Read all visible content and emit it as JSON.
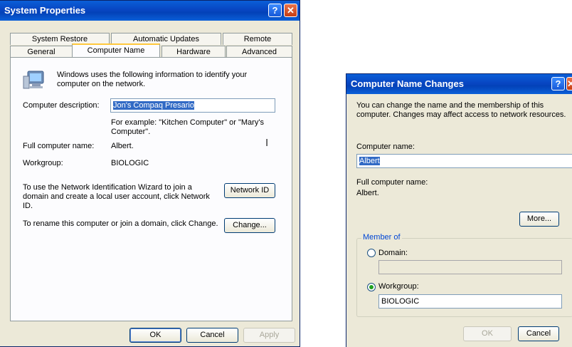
{
  "system_properties": {
    "title": "System Properties",
    "tabs_row1": [
      "System Restore",
      "Automatic Updates",
      "Remote"
    ],
    "tabs_row2": [
      "General",
      "Computer Name",
      "Hardware",
      "Advanced"
    ],
    "intro_text": "Windows uses the following information to identify your computer on the network.",
    "description_label": "Computer description:",
    "description_value": "Jon's Compaq Presario",
    "example_text": "For example: \"Kitchen Computer\" or \"Mary's Computer\".",
    "full_name_label": "Full computer name:",
    "full_name_value": "Albert.",
    "workgroup_label": "Workgroup:",
    "workgroup_value": "BIOLOGIC",
    "network_text": "To use the Network Identification Wizard to join a domain and create a local user account, click Network ID.",
    "network_button": "Network ID",
    "rename_text": "To rename this computer or join a domain, click Change.",
    "change_button": "Change...",
    "ok_button": "OK",
    "cancel_button": "Cancel",
    "apply_button": "Apply"
  },
  "name_changes": {
    "title": "Computer Name Changes",
    "intro_text": "You can change the name and the membership of this computer. Changes may affect access to network resources.",
    "computer_name_label": "Computer name:",
    "computer_name_value": "Albert",
    "full_name_label": "Full computer name:",
    "full_name_value": "Albert.",
    "more_button": "More...",
    "member_of_label": "Member of",
    "domain_label": "Domain:",
    "domain_value": "",
    "workgroup_label": "Workgroup:",
    "workgroup_value": "BIOLOGIC",
    "selected_membership": "Workgroup",
    "ok_button": "OK",
    "cancel_button": "Cancel"
  }
}
